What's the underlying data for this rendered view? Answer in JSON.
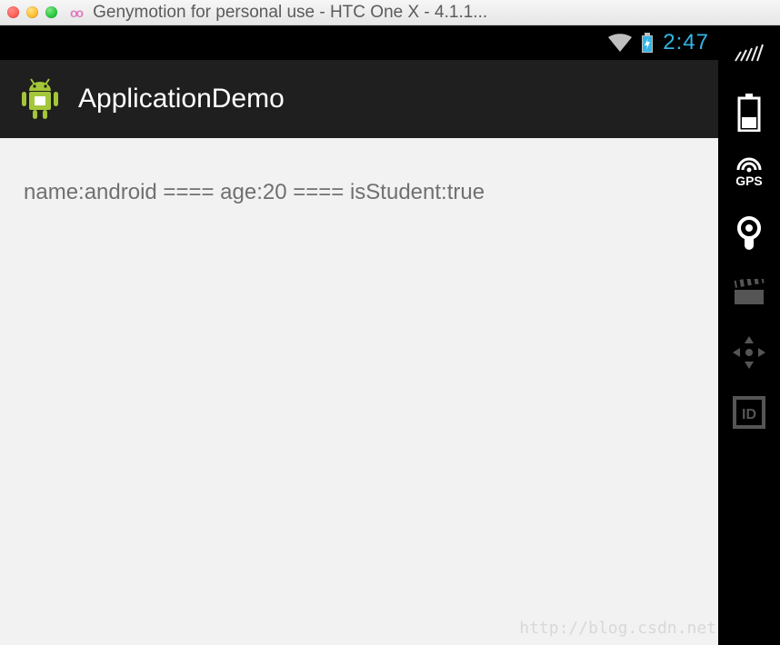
{
  "window": {
    "title": "Genymotion for personal use - HTC One X - 4.1.1...",
    "app_glyph": "oo"
  },
  "statusbar": {
    "time": "2:47"
  },
  "actionbar": {
    "title": "ApplicationDemo"
  },
  "content": {
    "text": "name:android  ==== age:20  ==== isStudent:true"
  },
  "side_tools": {
    "volume_label": "volume-icon",
    "battery_label": "battery-icon",
    "gps_label": "GPS",
    "camera_label": "camera-icon",
    "clapper_label": "clapperboard-icon",
    "dpad_label": "dpad-icon",
    "id_label": "ID"
  },
  "watermark": "http://blog.csdn.net"
}
